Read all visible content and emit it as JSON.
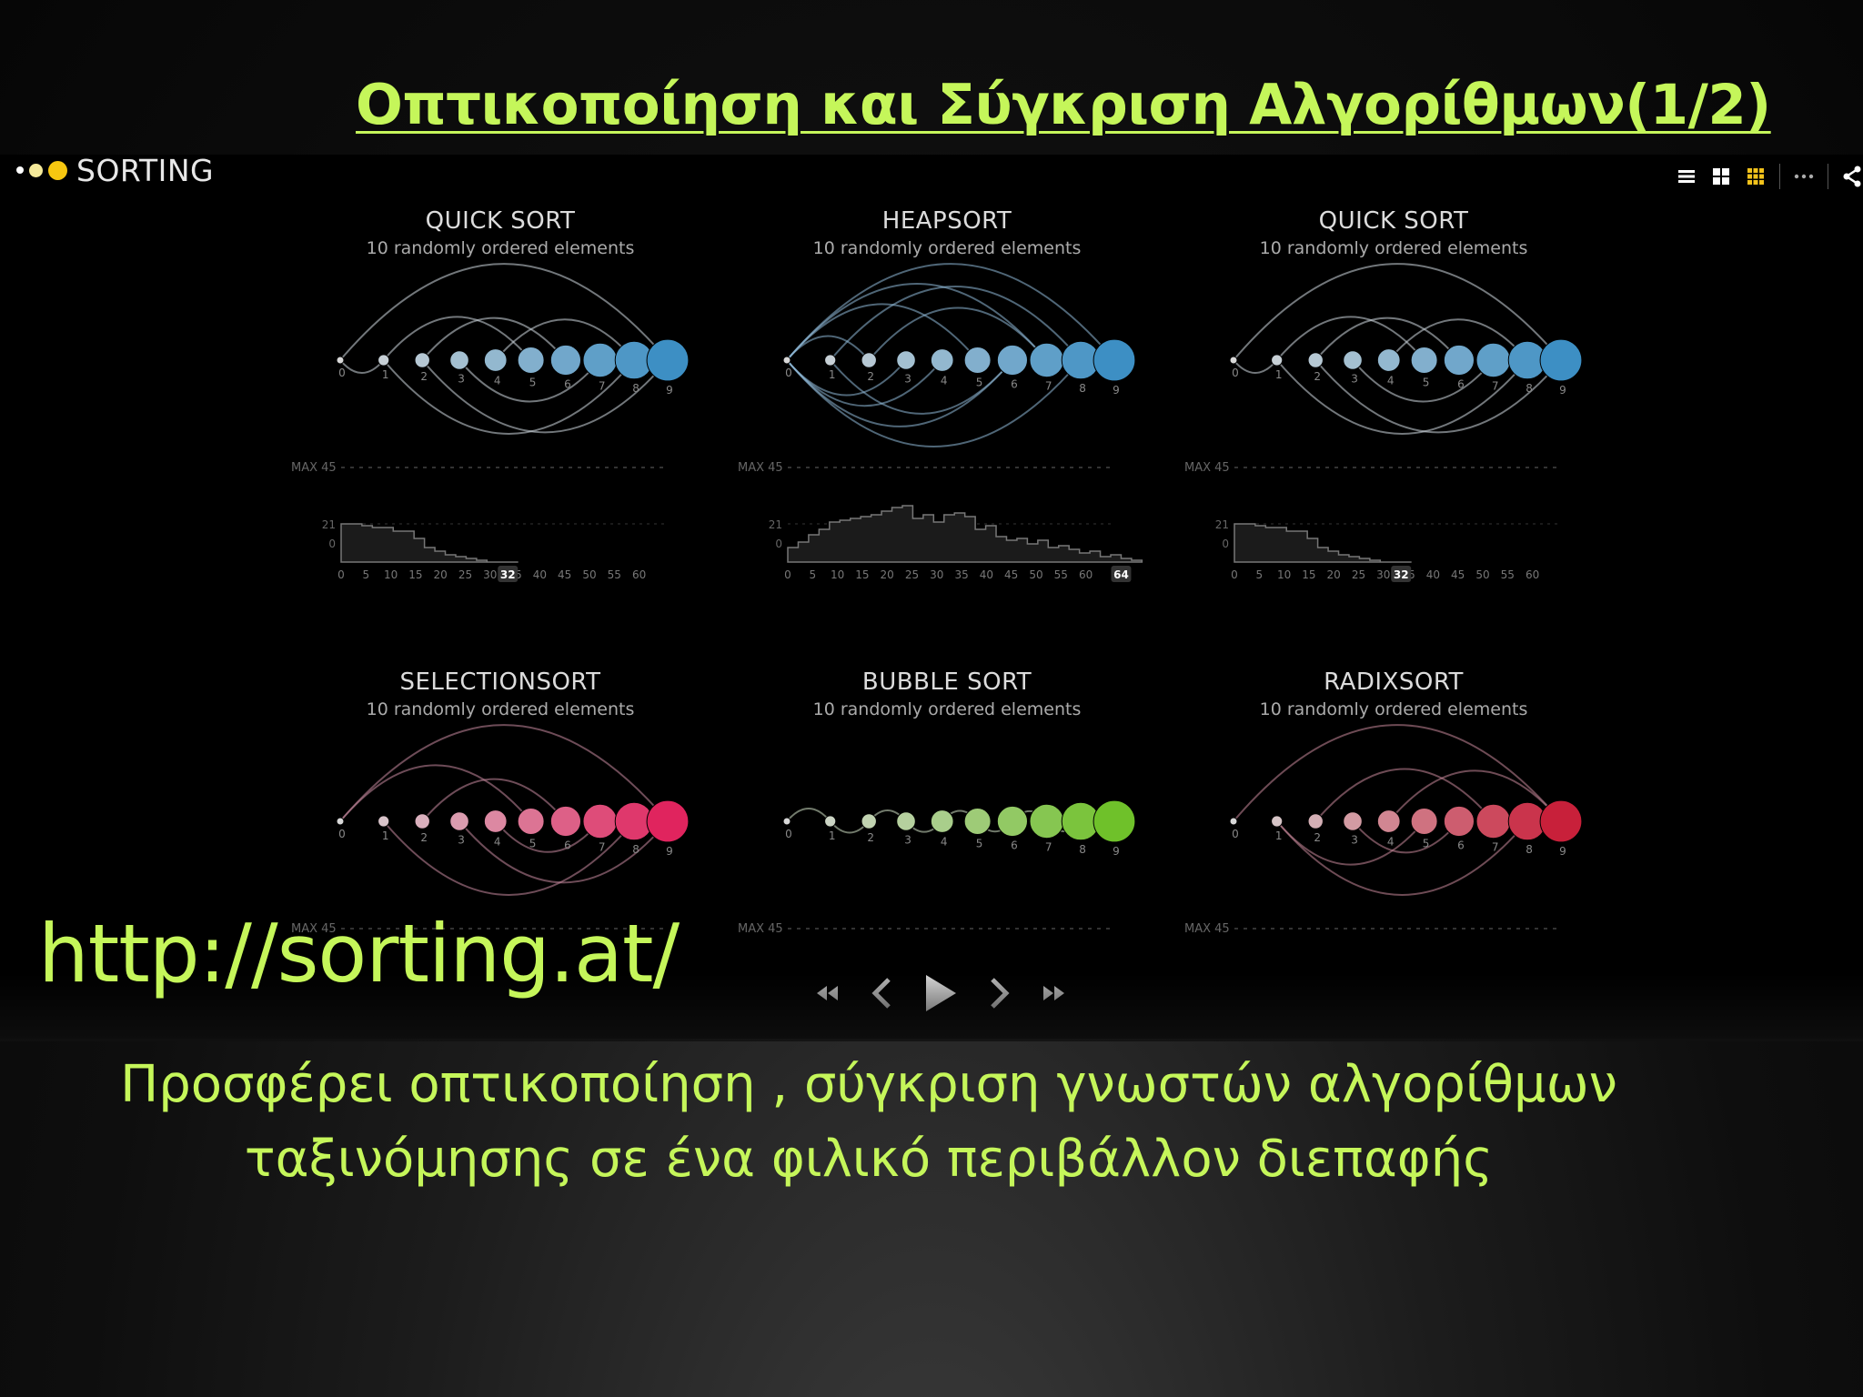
{
  "slide": {
    "title": "Οπτικοποίηση και Σύγκριση Αλγορίθμων(1/2)",
    "url": "http://sorting.at/",
    "description_line1": "Προσφέρει οπτικοποίηση , σύγκριση γνωστών αλγορίθμων",
    "description_line2": "ταξινόμησης σε ένα φιλικό περιβάλλον διεπαφής"
  },
  "app": {
    "name": "SORTING",
    "toolbar": [
      "list-view-icon",
      "grid-2-icon",
      "grid-3-icon",
      "more-icon",
      "share-icon"
    ]
  },
  "panels": [
    {
      "title": "QUICK SORT",
      "subtitle": "10 randomly ordered elements",
      "color": "#3d8fc4",
      "chart": {
        "max_label": "MAX 45",
        "y_ticks": [
          "21",
          "0"
        ],
        "x_ticks": [
          "0",
          "5",
          "10",
          "15",
          "20",
          "25",
          "30",
          "35",
          "40",
          "45",
          "50",
          "55",
          "60"
        ],
        "current": "32",
        "steps": [
          21,
          21,
          20,
          19,
          19,
          17,
          17,
          13,
          8,
          6,
          4,
          3,
          2,
          1,
          0,
          0,
          0
        ]
      }
    },
    {
      "title": "HEAPSORT",
      "subtitle": "10 randomly ordered elements",
      "color": "#3d8fc4",
      "chart": {
        "max_label": "MAX 45",
        "y_ticks": [
          "21",
          "0"
        ],
        "x_ticks": [
          "0",
          "5",
          "10",
          "15",
          "20",
          "25",
          "30",
          "35",
          "40",
          "45",
          "50",
          "55",
          "60"
        ],
        "current": "64",
        "steps": [
          8,
          11,
          15,
          18,
          22,
          23,
          24,
          25,
          26,
          28,
          30,
          31,
          24,
          26,
          22,
          26,
          27,
          25,
          18,
          20,
          14,
          12,
          13,
          10,
          12,
          8,
          9,
          7,
          5,
          6,
          3,
          4,
          2,
          1
        ]
      }
    },
    {
      "title": "QUICK SORT",
      "subtitle": "10 randomly ordered elements",
      "color": "#3d8fc4",
      "chart": {
        "max_label": "MAX 45",
        "y_ticks": [
          "21",
          "0"
        ],
        "x_ticks": [
          "0",
          "5",
          "10",
          "15",
          "20",
          "25",
          "30",
          "35",
          "40",
          "45",
          "50",
          "55",
          "60"
        ],
        "current": "32",
        "steps": [
          21,
          21,
          20,
          19,
          19,
          17,
          17,
          13,
          8,
          6,
          4,
          3,
          2,
          1,
          0,
          0,
          0
        ]
      }
    },
    {
      "title": "SELECTIONSORT",
      "subtitle": "10 randomly ordered elements",
      "color": "#e0245e",
      "chart": {
        "max_label": "MAX 45",
        "y_ticks": [],
        "x_ticks": [],
        "current": "",
        "steps": []
      }
    },
    {
      "title": "BUBBLE SORT",
      "subtitle": "10 randomly ordered elements",
      "color": "#6fc12a",
      "chart": {
        "max_label": "MAX 45",
        "y_ticks": [],
        "x_ticks": [],
        "current": "",
        "steps": []
      }
    },
    {
      "title": "RADIXSORT",
      "subtitle": "10 randomly ordered elements",
      "color": "#c8203a",
      "chart": {
        "max_label": "MAX 45",
        "y_ticks": [],
        "x_ticks": [],
        "current": "",
        "steps": []
      }
    }
  ],
  "node_labels": [
    "0",
    "1",
    "2",
    "3",
    "4",
    "5",
    "6",
    "7",
    "8",
    "9"
  ],
  "player": [
    "rewind-icon",
    "step-back-icon",
    "play-icon",
    "step-forward-icon",
    "fast-forward-icon"
  ]
}
